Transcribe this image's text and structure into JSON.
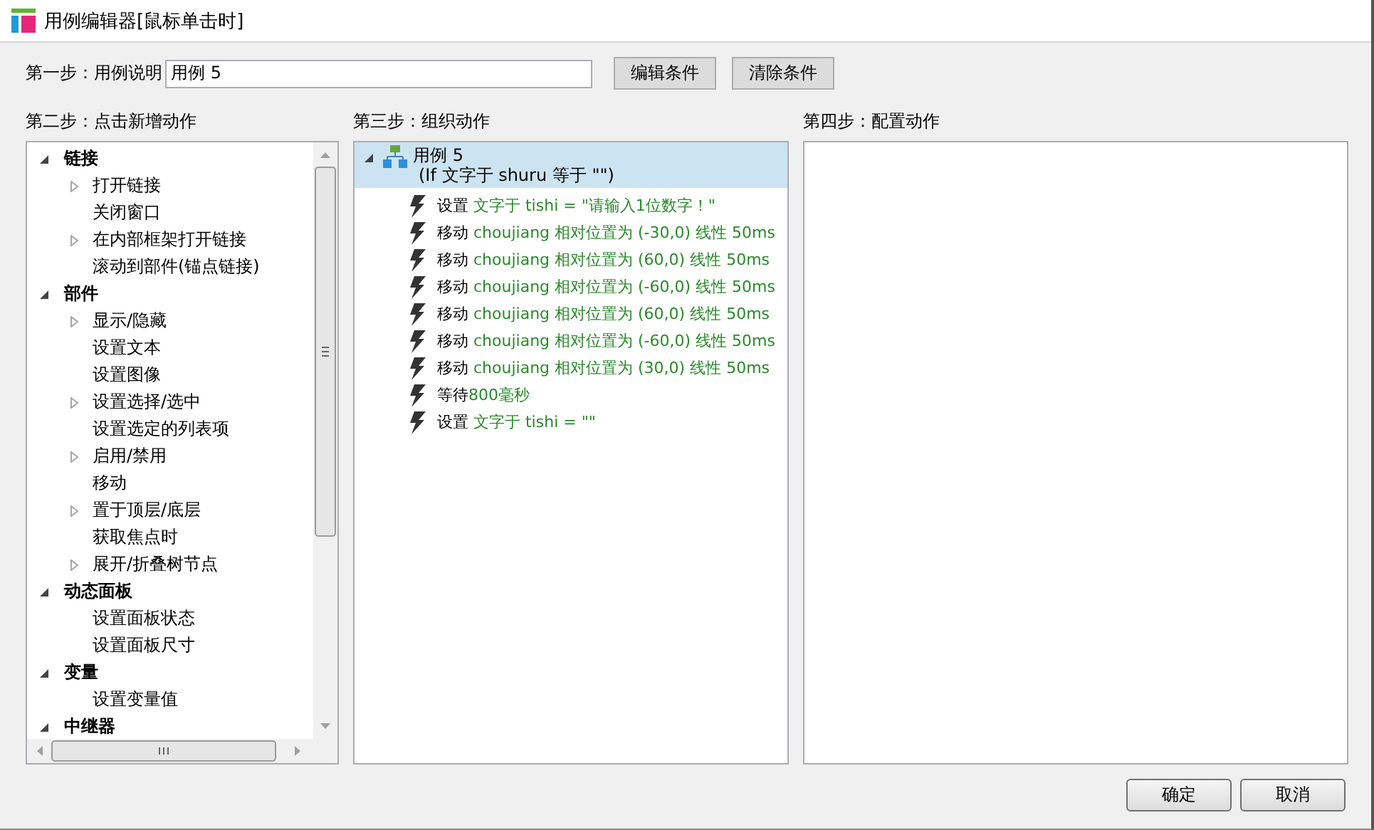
{
  "window": {
    "title": "用例编辑器[鼠标单击时]"
  },
  "step1": {
    "label": "第一步：用例说明",
    "value": "用例 5",
    "buttons": [
      "编辑条件",
      "清除条件"
    ]
  },
  "step2": {
    "label": "第二步：点击新增动作"
  },
  "step3": {
    "label": "第三步：组织动作"
  },
  "step4": {
    "label": "第四步：配置动作"
  },
  "left_tree": {
    "groups": [
      {
        "label": "链接",
        "expanded": true,
        "children": [
          {
            "label": "打开链接",
            "expandable": true
          },
          {
            "label": "关闭窗口",
            "expandable": false
          },
          {
            "label": "在内部框架打开链接",
            "expandable": true
          },
          {
            "label": "滚动到部件(锚点链接)",
            "expandable": false
          }
        ]
      },
      {
        "label": "部件",
        "expanded": true,
        "children": [
          {
            "label": "显示/隐藏",
            "expandable": true
          },
          {
            "label": "设置文本",
            "expandable": false
          },
          {
            "label": "设置图像",
            "expandable": false
          },
          {
            "label": "设置选择/选中",
            "expandable": true
          },
          {
            "label": "设置选定的列表项",
            "expandable": false
          },
          {
            "label": "启用/禁用",
            "expandable": true
          },
          {
            "label": "移动",
            "expandable": false
          },
          {
            "label": "置于顶层/底层",
            "expandable": true
          },
          {
            "label": "获取焦点时",
            "expandable": false
          },
          {
            "label": "展开/折叠树节点",
            "expandable": true
          }
        ]
      },
      {
        "label": "动态面板",
        "expanded": true,
        "children": [
          {
            "label": "设置面板状态",
            "expandable": false
          },
          {
            "label": "设置面板尺寸",
            "expandable": false
          }
        ]
      },
      {
        "label": "变量",
        "expanded": true,
        "children": [
          {
            "label": "设置变量值",
            "expandable": false
          }
        ]
      },
      {
        "label": "中继器",
        "expanded": true
      }
    ]
  },
  "case": {
    "name": "用例 5",
    "condition": "(If 文字于 shuru 等于 \"\")",
    "selected": true,
    "expanded": true,
    "actions": [
      {
        "verb": "设置",
        "detail": " 文字于 tishi = \"请输入1位数字！\""
      },
      {
        "verb": "移动",
        "detail": " choujiang 相对位置为 (-30,0) 线性 50ms"
      },
      {
        "verb": "移动",
        "detail": " choujiang 相对位置为 (60,0) 线性 50ms"
      },
      {
        "verb": "移动",
        "detail": " choujiang 相对位置为 (-60,0) 线性 50ms"
      },
      {
        "verb": "移动",
        "detail": " choujiang 相对位置为 (60,0) 线性 50ms"
      },
      {
        "verb": "移动",
        "detail": " choujiang 相对位置为 (-60,0) 线性 50ms"
      },
      {
        "verb": "移动",
        "detail": " choujiang 相对位置为 (30,0) 线性 50ms"
      },
      {
        "verb": "等待",
        "detail": "800毫秒"
      },
      {
        "verb": "设置",
        "detail": " 文字于 tishi = \"\""
      }
    ]
  },
  "footer_buttons": [
    "确定",
    "取消"
  ]
}
